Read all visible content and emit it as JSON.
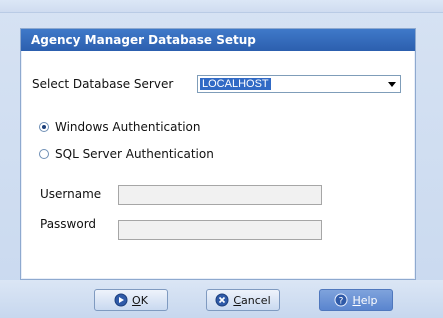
{
  "dialog": {
    "title": "Agency Manager Database Setup"
  },
  "server": {
    "label": "Select Database Server",
    "value": "LOCALHOST"
  },
  "auth": {
    "windows_label": "Windows Authentication",
    "sql_label": "SQL Server Authentication",
    "selected": "windows"
  },
  "credentials": {
    "username_label": "Username",
    "password_label": "Password",
    "username_value": "",
    "password_value": ""
  },
  "buttons": {
    "ok": {
      "accel": "O",
      "rest": "K",
      "icon": "play-circle-icon"
    },
    "cancel": {
      "accel": "C",
      "rest": "ancel",
      "icon": "cancel-circle-icon"
    },
    "help": {
      "accel": "H",
      "rest": "elp",
      "icon": "help-circle-icon"
    }
  },
  "colors": {
    "title_bar": "#2c5fae",
    "selection": "#316ac5",
    "active_button": "#5a85cf"
  }
}
